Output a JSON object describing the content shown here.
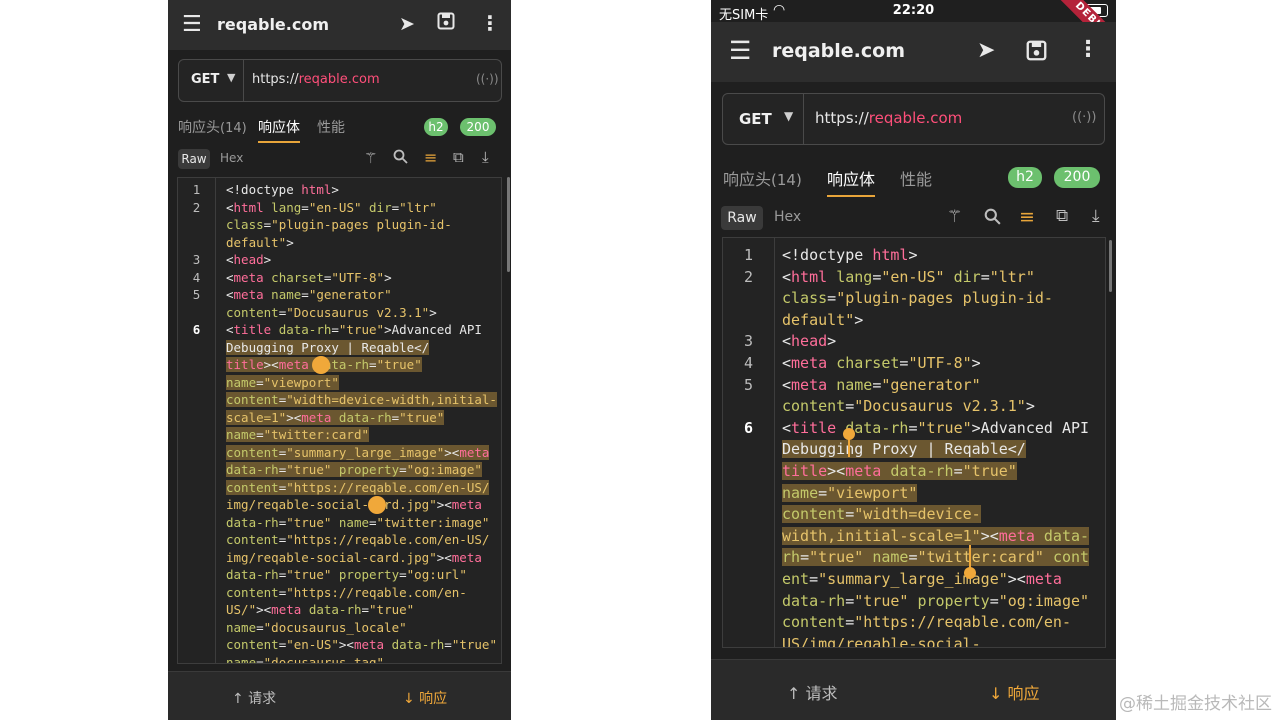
{
  "app": {
    "title": "reqable.com",
    "menu_icon": "menu-icon",
    "send_icon": "send-icon",
    "save_icon": "save-icon",
    "more_icon": "more-vert-icon"
  },
  "status_bar": {
    "carrier": "无SIM卡",
    "time": "22:20",
    "debug_banner": "DEBUG"
  },
  "request": {
    "method": "GET",
    "url_scheme": "https://",
    "url_host": "reqable.com"
  },
  "tabs": [
    {
      "label": "响应头",
      "count": "(14)"
    },
    {
      "label": "响应体",
      "count": ""
    },
    {
      "label": "性能",
      "count": ""
    }
  ],
  "active_tab": "响应体",
  "badges": {
    "protocol": "h2",
    "status": "200"
  },
  "body_view": {
    "raw_label": "Raw",
    "hex_label": "Hex"
  },
  "toolbar_icons": [
    "magic-wand-icon",
    "search-icon",
    "wrap-text-icon",
    "copy-icon",
    "download-icon"
  ],
  "bottom_nav": {
    "request": "↑ 请求",
    "response": "↓ 响应"
  },
  "watermark": "@稀土掘金技术社区",
  "colors": {
    "accent": "#e8a53a",
    "badge": "#6cc06e",
    "url_host": "#ff4f7a",
    "selection": "#6b5730"
  },
  "left_lines": [
    [
      [
        "1",
        ""
      ],
      [
        [
          "t",
          "<!doctype "
        ],
        [
          "tg",
          "html"
        ],
        [
          "t",
          ">"
        ]
      ],
      false
    ],
    [
      [
        "2",
        ""
      ],
      [
        [
          "t",
          "<"
        ],
        [
          "tg",
          "html "
        ],
        [
          "at",
          "lang"
        ],
        [
          "t",
          "="
        ],
        [
          "vl",
          "\"en-US\" "
        ],
        [
          "at",
          "dir"
        ],
        [
          "t",
          "="
        ],
        [
          "vl",
          "\"ltr\""
        ]
      ],
      false
    ],
    [
      [
        "",
        ""
      ],
      [
        [
          "at",
          "class"
        ],
        [
          "t",
          "="
        ],
        [
          "vl",
          "\"plugin-pages plugin-id-"
        ]
      ],
      false
    ],
    [
      [
        "",
        ""
      ],
      [
        [
          "vl",
          "default\""
        ],
        [
          "t",
          ">"
        ]
      ],
      false
    ],
    [
      [
        "3",
        ""
      ],
      [
        [
          "t",
          "<"
        ],
        [
          "tg",
          "head"
        ],
        [
          "t",
          ">"
        ]
      ],
      false
    ],
    [
      [
        "4",
        ""
      ],
      [
        [
          "t",
          "<"
        ],
        [
          "tg",
          "meta "
        ],
        [
          "at",
          "charset"
        ],
        [
          "t",
          "="
        ],
        [
          "vl",
          "\"UTF-8\""
        ],
        [
          "t",
          ">"
        ]
      ],
      false
    ],
    [
      [
        "5",
        ""
      ],
      [
        [
          "t",
          "<"
        ],
        [
          "tg",
          "meta "
        ],
        [
          "at",
          "name"
        ],
        [
          "t",
          "="
        ],
        [
          "vl",
          "\"generator\""
        ]
      ],
      false
    ],
    [
      [
        "",
        ""
      ],
      [
        [
          "at",
          "content"
        ],
        [
          "t",
          "="
        ],
        [
          "vl",
          "\"Docusaurus v2.3.1\""
        ],
        [
          "t",
          ">"
        ]
      ],
      false
    ],
    [
      [
        "6",
        "cur"
      ],
      [
        [
          "t",
          "<"
        ],
        [
          "tg",
          "title "
        ],
        [
          "at",
          "data-rh"
        ],
        [
          "t",
          "="
        ],
        [
          "vl",
          "\"true\""
        ],
        [
          "t",
          ">Advanced API"
        ]
      ],
      false
    ],
    [
      [
        "",
        ""
      ],
      [
        [
          "t",
          "Debugging Proxy | Reqable</"
        ]
      ],
      true
    ],
    [
      [
        "",
        ""
      ],
      [
        [
          "tg",
          "title"
        ],
        [
          "t",
          "><"
        ],
        [
          "tg",
          "meta "
        ],
        [
          "at",
          "data-rh"
        ],
        [
          "t",
          "="
        ],
        [
          "vl",
          "\"true\""
        ]
      ],
      true
    ],
    [
      [
        "",
        ""
      ],
      [
        [
          "at",
          "name"
        ],
        [
          "t",
          "="
        ],
        [
          "vl",
          "\"viewport\""
        ]
      ],
      true
    ],
    [
      [
        "",
        ""
      ],
      [
        [
          "at",
          "content"
        ],
        [
          "t",
          "="
        ],
        [
          "vl",
          "\"width=device-width,initial-"
        ]
      ],
      true
    ],
    [
      [
        "",
        ""
      ],
      [
        [
          "vl",
          "scale=1\""
        ],
        [
          "t",
          "><"
        ],
        [
          "tg",
          "meta "
        ],
        [
          "at",
          "data-rh"
        ],
        [
          "t",
          "="
        ],
        [
          "vl",
          "\"true\""
        ]
      ],
      true
    ],
    [
      [
        "",
        ""
      ],
      [
        [
          "at",
          "name"
        ],
        [
          "t",
          "="
        ],
        [
          "vl",
          "\"twitter:card\""
        ]
      ],
      true
    ],
    [
      [
        "",
        ""
      ],
      [
        [
          "at",
          "content"
        ],
        [
          "t",
          "="
        ],
        [
          "vl",
          "\"summary_large_image\""
        ],
        [
          "t",
          "><"
        ],
        [
          "tg",
          "meta"
        ]
      ],
      true
    ],
    [
      [
        "",
        ""
      ],
      [
        [
          "at",
          "data-rh"
        ],
        [
          "t",
          "="
        ],
        [
          "vl",
          "\"true\" "
        ],
        [
          "at",
          "property"
        ],
        [
          "t",
          "="
        ],
        [
          "vl",
          "\"og:image\""
        ]
      ],
      true
    ],
    [
      [
        "",
        ""
      ],
      [
        [
          "at",
          "content"
        ],
        [
          "t",
          "="
        ],
        [
          "vl",
          "\"https://reqable.com/en-US/"
        ]
      ],
      true
    ],
    [
      [
        "",
        ""
      ],
      [
        [
          "vl",
          "img/reqable-social-card.jpg\""
        ],
        [
          "t",
          "><"
        ],
        [
          "tg",
          "meta"
        ]
      ],
      false
    ],
    [
      [
        "",
        ""
      ],
      [
        [
          "at",
          "data-rh"
        ],
        [
          "t",
          "="
        ],
        [
          "vl",
          "\"true\" "
        ],
        [
          "at",
          "name"
        ],
        [
          "t",
          "="
        ],
        [
          "vl",
          "\"twitter:image\""
        ]
      ],
      false
    ],
    [
      [
        "",
        ""
      ],
      [
        [
          "at",
          "content"
        ],
        [
          "t",
          "="
        ],
        [
          "vl",
          "\"https://reqable.com/en-US/"
        ]
      ],
      false
    ],
    [
      [
        "",
        ""
      ],
      [
        [
          "vl",
          "img/reqable-social-card.jpg\""
        ],
        [
          "t",
          "><"
        ],
        [
          "tg",
          "meta"
        ]
      ],
      false
    ],
    [
      [
        "",
        ""
      ],
      [
        [
          "at",
          "data-rh"
        ],
        [
          "t",
          "="
        ],
        [
          "vl",
          "\"true\" "
        ],
        [
          "at",
          "property"
        ],
        [
          "t",
          "="
        ],
        [
          "vl",
          "\"og:url\""
        ]
      ],
      false
    ],
    [
      [
        "",
        ""
      ],
      [
        [
          "at",
          "content"
        ],
        [
          "t",
          "="
        ],
        [
          "vl",
          "\"https://reqable.com/en-"
        ]
      ],
      false
    ],
    [
      [
        "",
        ""
      ],
      [
        [
          "vl",
          "US/\""
        ],
        [
          "t",
          "><"
        ],
        [
          "tg",
          "meta "
        ],
        [
          "at",
          "data-rh"
        ],
        [
          "t",
          "="
        ],
        [
          "vl",
          "\"true\""
        ]
      ],
      false
    ],
    [
      [
        "",
        ""
      ],
      [
        [
          "at",
          "name"
        ],
        [
          "t",
          "="
        ],
        [
          "vl",
          "\"docusaurus_locale\""
        ]
      ],
      false
    ],
    [
      [
        "",
        ""
      ],
      [
        [
          "at",
          "content"
        ],
        [
          "t",
          "="
        ],
        [
          "vl",
          "\"en-US\""
        ],
        [
          "t",
          "><"
        ],
        [
          "tg",
          "meta "
        ],
        [
          "at",
          "data-rh"
        ],
        [
          "t",
          "="
        ],
        [
          "vl",
          "\"true\""
        ]
      ],
      false
    ],
    [
      [
        "",
        ""
      ],
      [
        [
          "at",
          "name"
        ],
        [
          "t",
          "="
        ],
        [
          "vl",
          "\"docusaurus_tag\""
        ]
      ],
      false
    ]
  ],
  "right_lines": [
    [
      [
        "1",
        ""
      ],
      [
        [
          "t",
          "<!doctype "
        ],
        [
          "tg",
          "html"
        ],
        [
          "t",
          ">"
        ]
      ],
      false
    ],
    [
      [
        "2",
        ""
      ],
      [
        [
          "t",
          "<"
        ],
        [
          "tg",
          "html "
        ],
        [
          "at",
          "lang"
        ],
        [
          "t",
          "="
        ],
        [
          "vl",
          "\"en-US\" "
        ],
        [
          "at",
          "dir"
        ],
        [
          "t",
          "="
        ],
        [
          "vl",
          "\"ltr\""
        ]
      ],
      false
    ],
    [
      [
        "",
        ""
      ],
      [
        [
          "at",
          "class"
        ],
        [
          "t",
          "="
        ],
        [
          "vl",
          "\"plugin-pages plugin-id-"
        ]
      ],
      false
    ],
    [
      [
        "",
        ""
      ],
      [
        [
          "vl",
          "default\""
        ],
        [
          "t",
          ">"
        ]
      ],
      false
    ],
    [
      [
        "3",
        ""
      ],
      [
        [
          "t",
          "<"
        ],
        [
          "tg",
          "head"
        ],
        [
          "t",
          ">"
        ]
      ],
      false
    ],
    [
      [
        "4",
        ""
      ],
      [
        [
          "t",
          "<"
        ],
        [
          "tg",
          "meta "
        ],
        [
          "at",
          "charset"
        ],
        [
          "t",
          "="
        ],
        [
          "vl",
          "\"UTF-8\""
        ],
        [
          "t",
          ">"
        ]
      ],
      false
    ],
    [
      [
        "5",
        ""
      ],
      [
        [
          "t",
          "<"
        ],
        [
          "tg",
          "meta "
        ],
        [
          "at",
          "name"
        ],
        [
          "t",
          "="
        ],
        [
          "vl",
          "\"generator\""
        ]
      ],
      false
    ],
    [
      [
        "",
        ""
      ],
      [
        [
          "at",
          "content"
        ],
        [
          "t",
          "="
        ],
        [
          "vl",
          "\"Docusaurus v2.3.1\""
        ],
        [
          "t",
          ">"
        ]
      ],
      false
    ],
    [
      [
        "6",
        "cur"
      ],
      [
        [
          "t",
          "<"
        ],
        [
          "tg",
          "title "
        ],
        [
          "at",
          "data-rh"
        ],
        [
          "t",
          "="
        ],
        [
          "vl",
          "\"true\""
        ],
        [
          "t",
          ">Advanced API"
        ]
      ],
      false
    ],
    [
      [
        "",
        ""
      ],
      [
        [
          "t",
          "Debugging Proxy | Reqable</"
        ]
      ],
      true
    ],
    [
      [
        "",
        ""
      ],
      [
        [
          "tg",
          "title"
        ],
        [
          "t",
          "><"
        ],
        [
          "tg",
          "meta "
        ],
        [
          "at",
          "data-rh"
        ],
        [
          "t",
          "="
        ],
        [
          "vl",
          "\"true\""
        ]
      ],
      true
    ],
    [
      [
        "",
        ""
      ],
      [
        [
          "at",
          "name"
        ],
        [
          "t",
          "="
        ],
        [
          "vl",
          "\"viewport\""
        ]
      ],
      true
    ],
    [
      [
        "",
        ""
      ],
      [
        [
          "at",
          "content"
        ],
        [
          "t",
          "="
        ],
        [
          "vl",
          "\"width=device-"
        ]
      ],
      true
    ],
    [
      [
        "",
        ""
      ],
      [
        [
          "vl",
          "width,initial-scale=1\""
        ],
        [
          "t",
          "><"
        ],
        [
          "tg",
          "meta "
        ],
        [
          "at",
          "data-"
        ]
      ],
      true
    ],
    [
      [
        "",
        ""
      ],
      [
        [
          "at",
          "rh"
        ],
        [
          "t",
          "="
        ],
        [
          "vl",
          "\"true\" "
        ],
        [
          "at",
          "name"
        ],
        [
          "t",
          "="
        ],
        [
          "vl",
          "\"twitter:card\" "
        ],
        [
          "at",
          "cont"
        ]
      ],
      true
    ],
    [
      [
        "",
        ""
      ],
      [
        [
          "at",
          "ent"
        ],
        [
          "t",
          "="
        ],
        [
          "vl",
          "\"summary_large_image\""
        ],
        [
          "t",
          "><"
        ],
        [
          "tg",
          "meta"
        ]
      ],
      false
    ],
    [
      [
        "",
        ""
      ],
      [
        [
          "at",
          "data-rh"
        ],
        [
          "t",
          "="
        ],
        [
          "vl",
          "\"true\" "
        ],
        [
          "at",
          "property"
        ],
        [
          "t",
          "="
        ],
        [
          "vl",
          "\"og:image\""
        ]
      ],
      false
    ],
    [
      [
        "",
        ""
      ],
      [
        [
          "at",
          "content"
        ],
        [
          "t",
          "="
        ],
        [
          "vl",
          "\"https://reqable.com/en-"
        ]
      ],
      false
    ],
    [
      [
        "",
        ""
      ],
      [
        [
          "vl",
          "US/img/reqable-social-"
        ]
      ],
      false
    ]
  ]
}
